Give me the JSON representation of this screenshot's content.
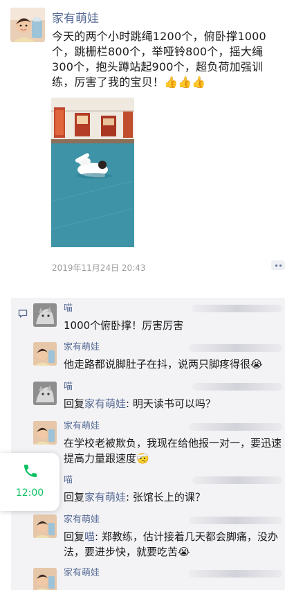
{
  "post": {
    "author": "家有萌娃",
    "text": "今天的两个小时跳绳1200个，俯卧撑1000个，跳栅栏800个，举哑铃800个，摇大绳300个，抱头蹲站起900个，超负荷加强训练，厉害了我的宝贝！",
    "thumbs": "👍👍👍",
    "timestamp": "2019年11月24日 20:43"
  },
  "comments": [
    {
      "author": "喵",
      "text": "1000个俯卧撑！厉害厉害",
      "avatar": "cat-avatar"
    },
    {
      "author": "家有萌娃",
      "text": "他走路都说脚肚子在抖，说两只脚疼得很😭",
      "avatar": "kid-avatar"
    },
    {
      "author": "喵",
      "reply_prefix": "回复",
      "reply_to": "家有萌娃",
      "text": ": 明天读书可以吗？",
      "avatar": "cat-avatar"
    },
    {
      "author": "家有萌娃",
      "text": "在学校老被欺负，我现在给他报一对一，要迅速提高力量跟速度🤕",
      "avatar": "kid-avatar"
    },
    {
      "author": "喵",
      "reply_prefix": "回复",
      "reply_to": "家有萌娃",
      "text": ": 张馆长上的课？",
      "avatar": "cat-avatar"
    },
    {
      "author": "家有萌娃",
      "reply_prefix": "回复",
      "reply_to": "喵",
      "text": ": 郑教练，估计接着几天都会脚痛，没办法，要进步快，就要吃苦😭",
      "avatar": "kid-avatar"
    },
    {
      "author": "家有萌娃",
      "avatar": "kid-avatar"
    }
  ],
  "call_widget": {
    "time": "12:00",
    "color": "#07c160"
  },
  "colors": {
    "link": "#576b95",
    "panel": "#f3f3f5",
    "call_green": "#07c160"
  }
}
